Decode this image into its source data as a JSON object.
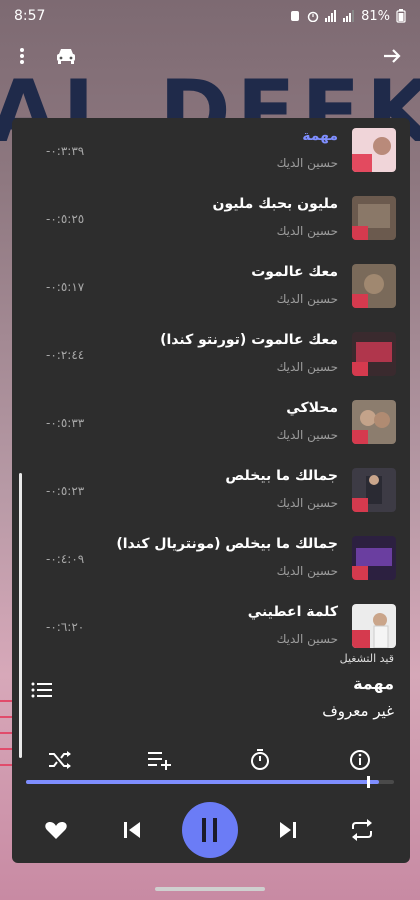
{
  "status_bar": {
    "time": "8:57",
    "battery": "81%"
  },
  "background": {
    "text": "AL DEEK"
  },
  "songs": [
    {
      "title": "مهمة",
      "artist": "حسين الديك",
      "duration": "-٠:٣:٣٩",
      "active": true
    },
    {
      "title": "مليون بحبك مليون",
      "artist": "حسين الديك",
      "duration": "-٠:٥:٢٥",
      "active": false
    },
    {
      "title": "معك عالموت",
      "artist": "حسين الديك",
      "duration": "-٠:٥:١٧",
      "active": false
    },
    {
      "title": "معك عالموت (تورنتو كندا)",
      "artist": "حسين الديك",
      "duration": "-٠:٢:٤٤",
      "active": false
    },
    {
      "title": "محلاكي",
      "artist": "حسين الديك",
      "duration": "-٠:٥:٣٣",
      "active": false
    },
    {
      "title": "جمالك ما بيخلص",
      "artist": "حسين الديك",
      "duration": "-٠:٥:٢٣",
      "active": false
    },
    {
      "title": "جمالك ما بيخلص (مونتريال كندا)",
      "artist": "حسين الديك",
      "duration": "-٠:٤:٠٩",
      "active": false
    },
    {
      "title": "كلمة اعطيني",
      "artist": "حسين الديك",
      "duration": "-٠:٦:٢٠",
      "active": false
    }
  ],
  "now_playing": {
    "label": "قيد التشغيل",
    "title": "مهمة",
    "artist": "غير معروف",
    "progress": 0.96
  },
  "colors": {
    "accent": "#6b7cf6",
    "active_title": "#7f8eff",
    "panel": "#2d2d2d"
  },
  "icons": {
    "top": [
      "more-vert-icon",
      "car-icon",
      "arrow-forward-icon"
    ],
    "tools": [
      "shuffle-icon",
      "playlist-add-icon",
      "timer-icon",
      "info-icon"
    ],
    "controls": [
      "heart-icon",
      "skip-previous-icon",
      "pause-icon",
      "skip-next-icon",
      "repeat-icon"
    ]
  }
}
